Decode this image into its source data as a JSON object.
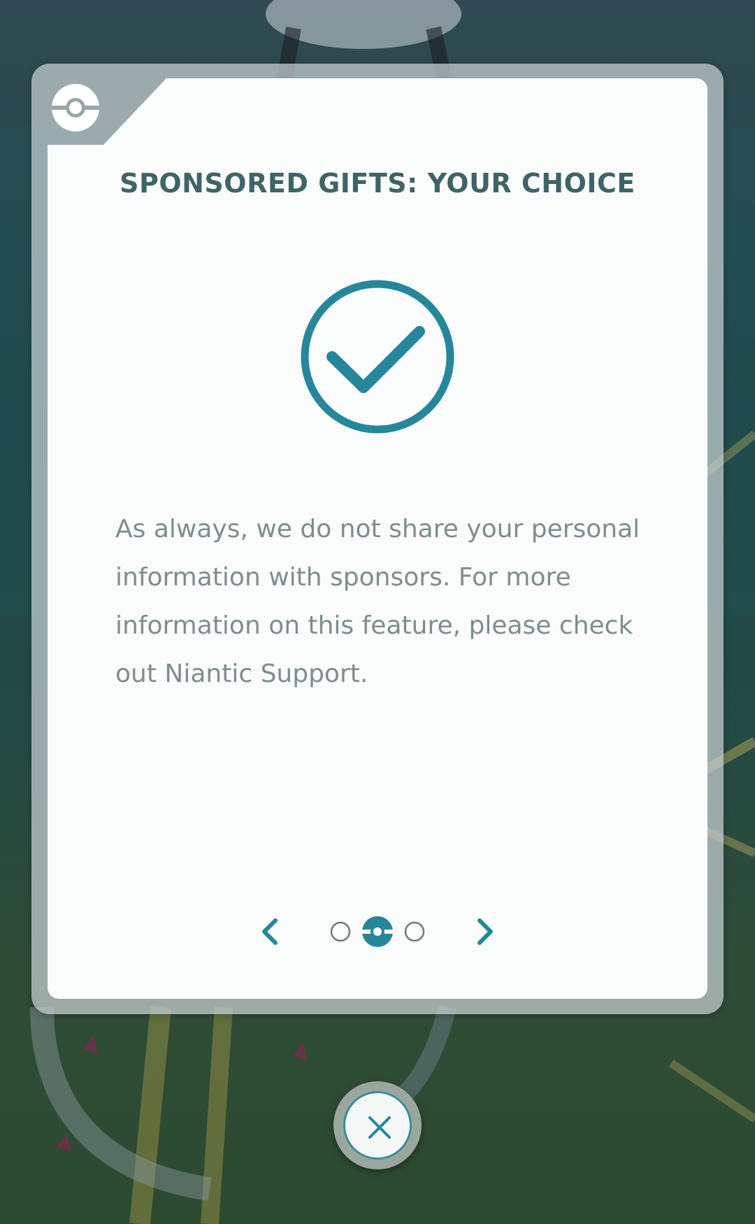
{
  "dialog": {
    "title": "SPONSORED GIFTS: YOUR CHOICE",
    "body": "As always, we do not share your personal information with sponsors. For more information on this feature, please check out Niantic Support."
  },
  "pager": {
    "page_count": 3,
    "current_page": 2
  },
  "icons": {
    "corner": "pokeball-icon",
    "main": "checkmark-circle-icon",
    "prev": "chevron-left-icon",
    "next": "chevron-right-icon",
    "close": "close-icon"
  },
  "colors": {
    "accent": "#27879a",
    "title": "#3f6468",
    "body_text": "#7c8e8f"
  }
}
